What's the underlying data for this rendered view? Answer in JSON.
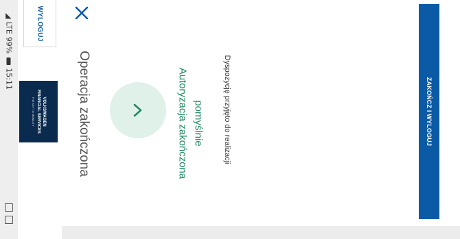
{
  "status_bar": {
    "time": "15:11",
    "battery": "99%",
    "network": "LTE",
    "signal_icon": "signal-icon",
    "battery_icon": "battery-icon"
  },
  "header": {
    "logout_label": "WYLOGUJ",
    "logo": {
      "line1": "VOLKSWAGEN",
      "line2": "FINANCIAL SERVICES",
      "tagline": "THE KEY TO MOBILITY"
    }
  },
  "dialog": {
    "title": "Operacja zakończona",
    "status_line1": "Autoryzacja zakończona",
    "status_line2": "pomyślnie",
    "detail": "Dyspozycję przyjęto do realizacji",
    "finish_button": "ZAKOŃCZ I WYLOGUJ",
    "colors": {
      "primary": "#0b5aa6",
      "success": "#1f8a63",
      "success_bg": "#dff1e8"
    }
  }
}
